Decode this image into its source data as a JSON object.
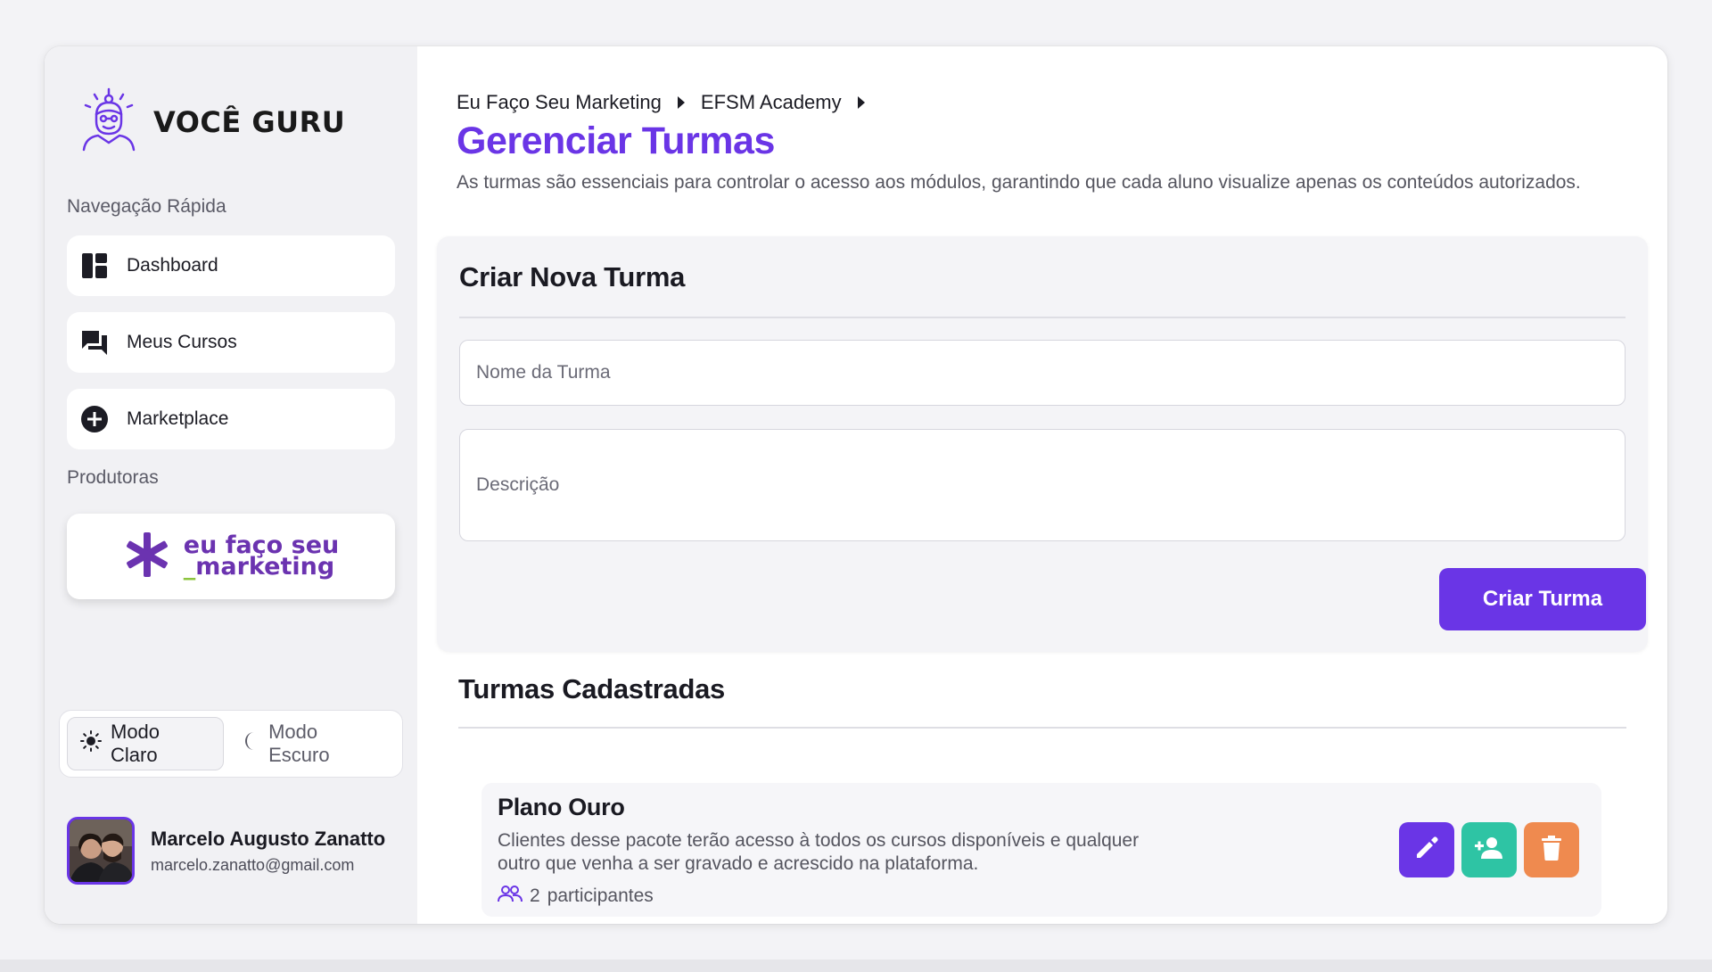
{
  "sidebar": {
    "logo_text": "VOCÊ GURU",
    "quick_nav_label": "Navegação Rápida",
    "items": [
      {
        "label": "Dashboard",
        "icon": "dashboard-icon"
      },
      {
        "label": "Meus Cursos",
        "icon": "chat-icon"
      },
      {
        "label": "Marketplace",
        "icon": "plus-circle-icon"
      }
    ],
    "producers_label": "Produtoras",
    "producer": {
      "line1": "eu faço seu",
      "line2_prefix": "_",
      "line2": "marketing"
    },
    "theme": {
      "light_label": "Modo Claro",
      "dark_label": "Modo Escuro",
      "selected": "Modo Claro"
    },
    "user": {
      "name": "Marcelo Augusto Zanatto",
      "email": "marcelo.zanatto@gmail.com"
    }
  },
  "header": {
    "breadcrumb": [
      "Eu Faço Seu Marketing",
      "EFSM Academy"
    ],
    "title": "Gerenciar Turmas",
    "description": "As turmas são essenciais para controlar o acesso aos módulos, garantindo que cada aluno visualize apenas os conteúdos autorizados."
  },
  "create_form": {
    "title": "Criar Nova Turma",
    "name_placeholder": "Nome da Turma",
    "description_placeholder": "Descrição",
    "submit_label": "Criar Turma"
  },
  "classes": {
    "title": "Turmas Cadastradas",
    "items": [
      {
        "name": "Plano Ouro",
        "description": "Clientes desse pacote terão acesso à todos os cursos disponíveis e qualquer outro que venha a ser gravado e acrescido na plataforma.",
        "participants_count": "2",
        "participants_label": "participantes"
      }
    ]
  },
  "colors": {
    "accent": "#6a35e6",
    "add_user": "#2ec4a4",
    "delete": "#ef8a4f",
    "producer": "#6b33b0"
  }
}
